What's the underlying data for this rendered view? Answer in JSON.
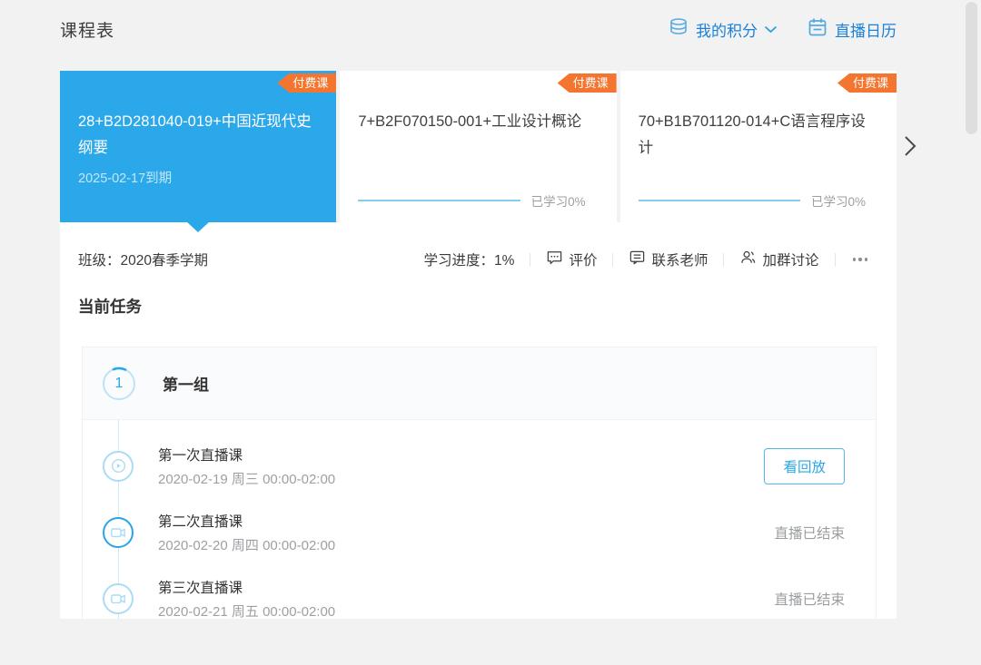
{
  "page": {
    "title": "课程表"
  },
  "header": {
    "points_label": "我的积分",
    "calendar_label": "直播日历",
    "calendar_has_notification": true
  },
  "colors": {
    "accent_blue": "#2BA8EA",
    "link_blue": "#1B80D8",
    "badge_orange": "#F4752F",
    "notification_red": "#F5303B",
    "background_gray": "#F2F2F3"
  },
  "courses": {
    "badge_label": "付费课",
    "cards": [
      {
        "title": "28+B2D281040-019+中国近现代史纲要",
        "expiry": "2025-02-17到期",
        "active": true
      },
      {
        "title": "7+B2F070150-001+工业设计概论",
        "progress_label": "已学习0%"
      },
      {
        "title": "70+B1B701120-014+C语言程序设计",
        "progress_label": "已学习0%"
      }
    ]
  },
  "course_info": {
    "class_label": "班级：2020春季学期",
    "progress_label": "学习进度：1%",
    "actions": [
      "评价",
      "联系老师",
      "加群讨论"
    ]
  },
  "tasks": {
    "heading": "当前任务",
    "group": {
      "number": "1",
      "name": "第一组"
    },
    "items": [
      {
        "title": "第一次直播课",
        "time": "2020-02-19 周三 00:00-02:00",
        "action": "看回放"
      },
      {
        "title": "第二次直播课",
        "time": "2020-02-20 周四 00:00-02:00",
        "status": "直播已结束"
      },
      {
        "title": "第三次直播课",
        "time": "2020-02-21 周五 00:00-02:00",
        "status": "直播已结束"
      }
    ]
  }
}
